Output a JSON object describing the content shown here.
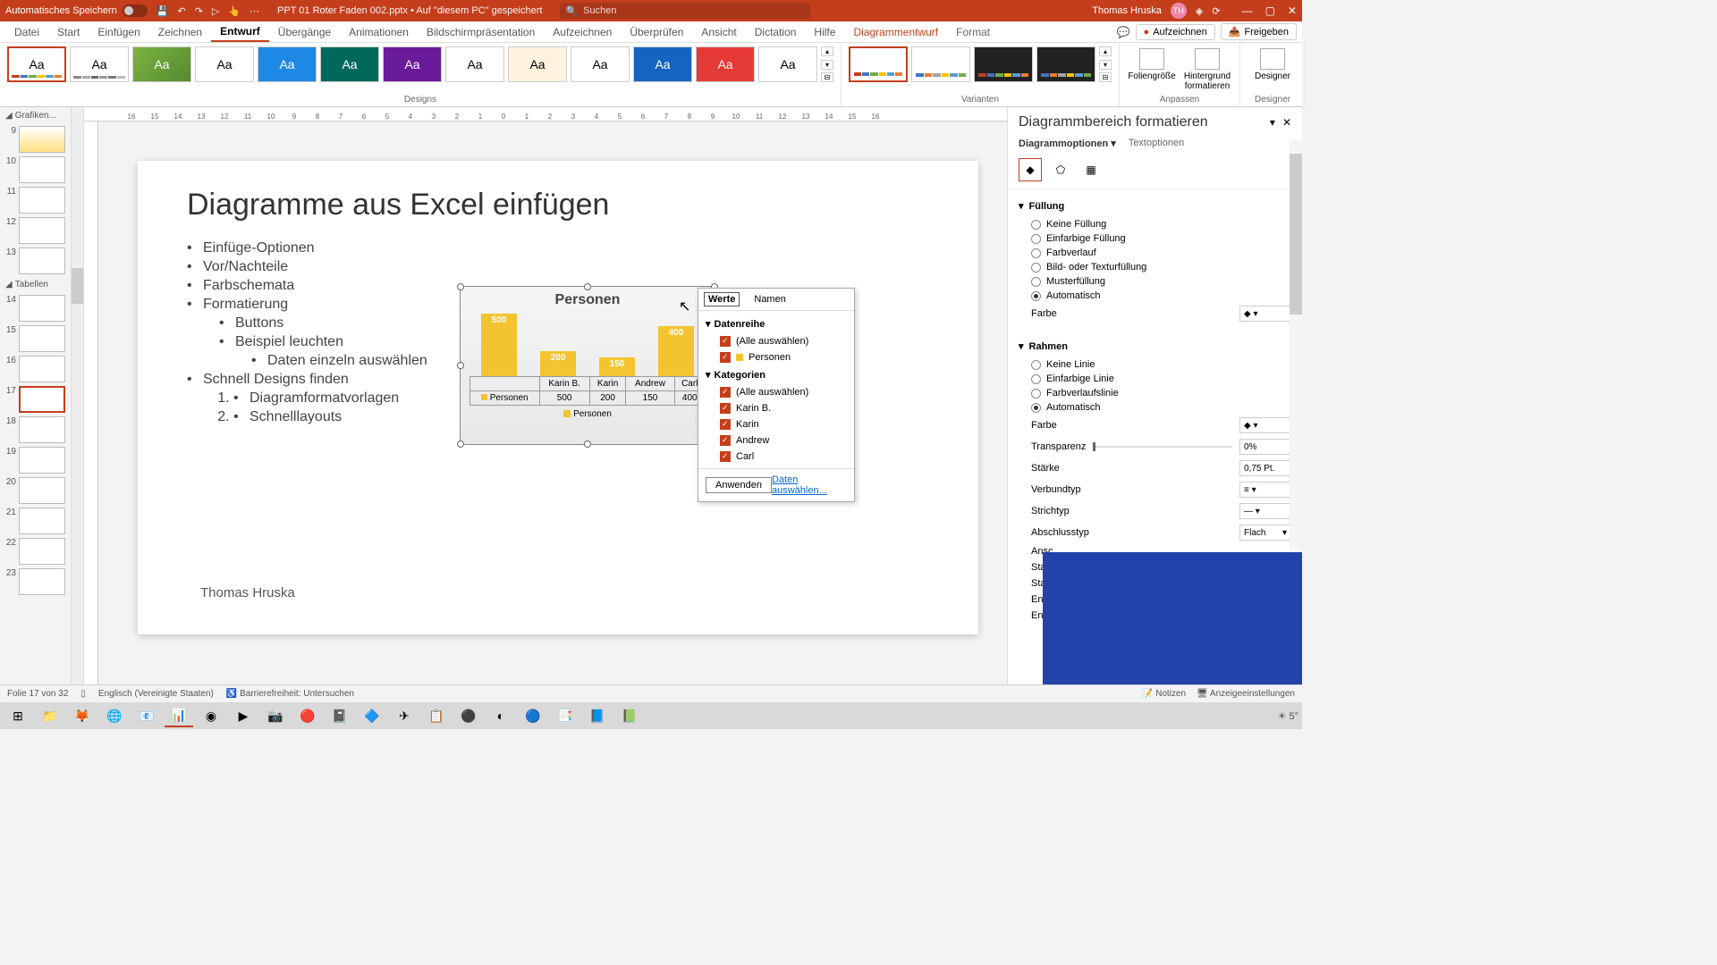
{
  "titlebar": {
    "autosave": "Automatisches Speichern",
    "docname": "PPT 01 Roter Faden 002.pptx • Auf \"diesem PC\" gespeichert",
    "search_placeholder": "Suchen",
    "user_name": "Thomas Hruska",
    "user_initials": "TH"
  },
  "tabs": {
    "items": [
      "Datei",
      "Start",
      "Einfügen",
      "Zeichnen",
      "Entwurf",
      "Übergänge",
      "Animationen",
      "Bildschirmpräsentation",
      "Aufzeichnen",
      "Überprüfen",
      "Ansicht",
      "Dictation",
      "Hilfe",
      "Diagrammentwurf",
      "Format"
    ],
    "active": "Entwurf",
    "record": "Aufzeichnen",
    "share": "Freigeben"
  },
  "ribbon": {
    "designs_label": "Designs",
    "variants_label": "Varianten",
    "customize_label": "Anpassen",
    "designer_label": "Designer",
    "slide_size": "Foliengröße",
    "format_bg": "Hintergrund formatieren",
    "designer_btn": "Designer"
  },
  "thumbs": {
    "section1": "Grafiken...",
    "section2": "Tabellen",
    "slides": [
      "9",
      "10",
      "11",
      "12",
      "13",
      "14",
      "15",
      "16",
      "17",
      "18",
      "19",
      "20",
      "21",
      "22",
      "23"
    ],
    "active": "17"
  },
  "slide": {
    "title": "Diagramme aus Excel einfügen",
    "bullets": {
      "b1": "Einfüge-Optionen",
      "b2": "Vor/Nachteile",
      "b3": "Farbschemata",
      "b4": "Formatierung",
      "b4a": "Buttons",
      "b4b": "Beispiel leuchten",
      "b4b1": "Daten einzeln auswählen",
      "b5": "Schnell Designs finden",
      "b5a": "Diagramformatvorlagen",
      "b5b": "Schnelllayouts"
    },
    "author": "Thomas Hruska"
  },
  "chart_data": {
    "type": "bar",
    "title": "Personen",
    "categories": [
      "Karin B.",
      "Karin",
      "Andrew",
      "Carl"
    ],
    "series": [
      {
        "name": "Personen",
        "values": [
          500,
          200,
          150,
          400
        ]
      }
    ],
    "row_label": "Personen",
    "legend": "Personen"
  },
  "filter": {
    "tab_values": "Werte",
    "tab_names": "Namen",
    "series_h": "Datenreihe",
    "all": "(Alle auswählen)",
    "s1": "Personen",
    "cat_h": "Kategorien",
    "c1": "Karin B.",
    "c2": "Karin",
    "c3": "Andrew",
    "c4": "Carl",
    "apply": "Anwenden",
    "select_data": "Daten auswählen..."
  },
  "format_pane": {
    "title": "Diagrammbereich formatieren",
    "tab_chart": "Diagrammoptionen",
    "tab_text": "Textoptionen",
    "fill_h": "Füllung",
    "fill": {
      "none": "Keine Füllung",
      "solid": "Einfarbige Füllung",
      "grad": "Farbverlauf",
      "pic": "Bild- oder Texturfüllung",
      "pattern": "Musterfüllung",
      "auto": "Automatisch"
    },
    "color": "Farbe",
    "border_h": "Rahmen",
    "border": {
      "none": "Keine Linie",
      "solid": "Einfarbige Linie",
      "grad": "Farbverlaufslinie",
      "auto": "Automatisch"
    },
    "transparency": "Transparenz",
    "transparency_val": "0%",
    "width": "Stärke",
    "width_val": "0,75 Pt.",
    "compound": "Verbundtyp",
    "dash": "Strichtyp",
    "cap": "Abschlusstyp",
    "cap_val": "Flach",
    "join": "Ansc",
    "arrow_start": "Start",
    "arrow_start_size": "Start",
    "arrow_end": "End",
    "arrow_end_size": "End"
  },
  "statusbar": {
    "slide": "Folie 17 von 32",
    "lang": "Englisch (Vereinigte Staaten)",
    "access": "Barrierefreiheit: Untersuchen",
    "notes": "Notizen",
    "display": "Anzeigeeinstellungen"
  },
  "taskbar": {
    "temp": "5°"
  }
}
